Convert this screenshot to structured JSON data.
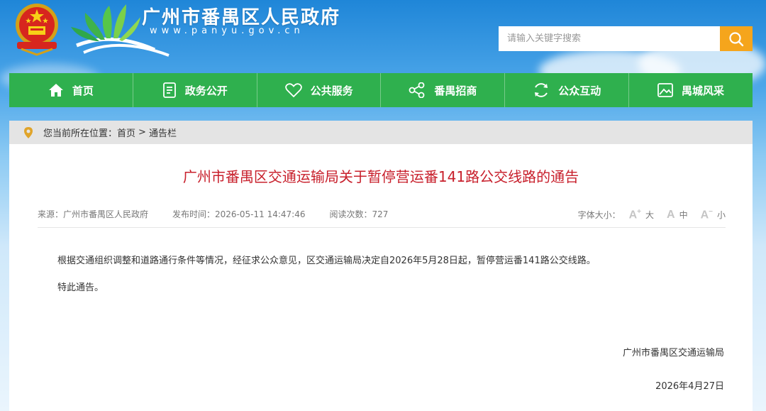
{
  "header": {
    "site_title": "广州市番禺区人民政府",
    "site_url": "www.panyu.gov.cn",
    "search_placeholder": "请输入关键字搜索",
    "search_value": ""
  },
  "nav": {
    "items": [
      {
        "label": "首页",
        "icon": "home-icon"
      },
      {
        "label": "政务公开",
        "icon": "document-icon"
      },
      {
        "label": "公共服务",
        "icon": "heart-icon"
      },
      {
        "label": "番禺招商",
        "icon": "share-nodes-icon"
      },
      {
        "label": "公众互动",
        "icon": "refresh-icon"
      },
      {
        "label": "禺城风采",
        "icon": "landscape-icon"
      }
    ]
  },
  "breadcrumb": {
    "prefix": "您当前所在位置：",
    "home": "首页",
    "separator": ">",
    "current": "通告栏"
  },
  "article": {
    "title": "广州市番禺区交通运输局关于暂停营运番141路公交线路的通告",
    "source": "来源：广州市番禺区人民政府",
    "publish_time": "发布时间：2026-05-11 14:47:46",
    "read_count": "阅读次数：727",
    "font_size_label": "字体大小：",
    "font_large": "大",
    "font_medium": "中",
    "font_small": "小",
    "paragraph_1": "根据交通组织调整和道路通行条件等情况，经征求公众意见，区交通运输局决定自2026年5月28日起，暂停营运番141路公交线路。",
    "paragraph_2": "特此通告。",
    "signature_org": "广州市番禺区交通运输局",
    "signature_date": "2026年4月27日"
  },
  "colors": {
    "nav_green": "#2fb04e",
    "title_red": "#c8202c",
    "search_orange": "#f5a51c"
  }
}
